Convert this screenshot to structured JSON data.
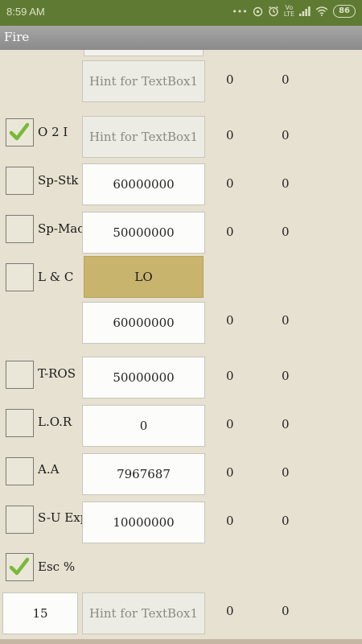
{
  "status_bar": {
    "time": "8:59 AM",
    "icons": [
      "more-dots-icon",
      "data-saver-icon",
      "alarm-icon",
      "volte-icon",
      "signal-icon",
      "wifi-icon"
    ],
    "volte_label": "Vo\nLTE",
    "battery": "86"
  },
  "app": {
    "title": "Fire"
  },
  "rows": [
    {
      "checkbox": null,
      "label": "",
      "textbox": "Hint for TextBox1",
      "is_hint": true,
      "n1": "0",
      "n2": "0"
    },
    {
      "checkbox": true,
      "label": "O 2 I",
      "textbox": "Hint for TextBox1",
      "is_hint": true,
      "n1": "0",
      "n2": "0"
    },
    {
      "checkbox": false,
      "label": "Sp-Stk",
      "textbox": "60000000",
      "is_hint": false,
      "n1": "0",
      "n2": "0"
    },
    {
      "checkbox": false,
      "label": "Sp-Mac",
      "textbox": "50000000",
      "is_hint": false,
      "n1": "0",
      "n2": "0"
    },
    {
      "checkbox": false,
      "label": "L & C",
      "button": "LO"
    },
    {
      "checkbox": null,
      "label": "",
      "textbox": "60000000",
      "is_hint": false,
      "n1": "0",
      "n2": "0"
    },
    {
      "checkbox": false,
      "label": "T-ROS",
      "textbox": "50000000",
      "is_hint": false,
      "n1": "0",
      "n2": "0"
    },
    {
      "checkbox": false,
      "label": "L.O.R",
      "textbox": "0",
      "is_hint": false,
      "n1": "0",
      "n2": "0"
    },
    {
      "checkbox": false,
      "label": "A.A",
      "textbox": "7967687",
      "is_hint": false,
      "n1": "0",
      "n2": "0"
    },
    {
      "checkbox": false,
      "label": "S-U Exp",
      "textbox": "10000000",
      "is_hint": false,
      "n1": "0",
      "n2": "0"
    },
    {
      "checkbox": true,
      "label": "Esc %"
    },
    {
      "left_box": "15",
      "textbox": "Hint for TextBox1",
      "is_hint": true,
      "n1": "0",
      "n2": "0"
    }
  ],
  "colors": {
    "status_bar": "#5f7a32",
    "app_bar": "#9a9a9a",
    "background": "#e6e1d0",
    "lo_button": "#c9b46e",
    "check": "#7ab83a"
  }
}
